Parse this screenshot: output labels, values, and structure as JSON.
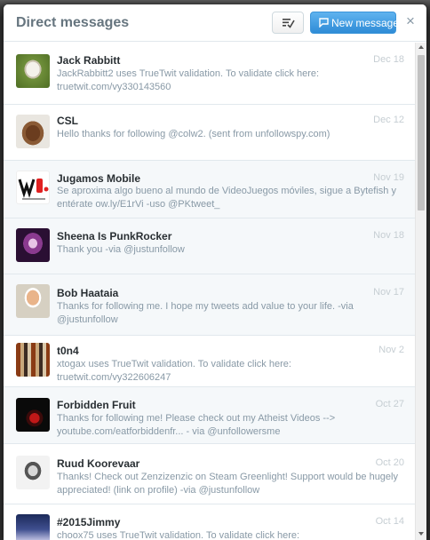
{
  "modal": {
    "title": "Direct messages",
    "new_message_label": "New message",
    "close_glyph": "×",
    "icons": {
      "compose_toggle": "mark-read-icon",
      "new_message": "message-bubble-icon",
      "close": "close-icon"
    },
    "accent_color": "#3b94d9"
  },
  "conversations": [
    {
      "name": "Jack Rabbitt",
      "date": "Dec 18",
      "preview": "JackRabbitt2 uses TrueTwit validation. To validate click here: truetwit.com/vy330143560",
      "avatar_icon": "rabbit-photo-avatar",
      "unread": false
    },
    {
      "name": "CSL",
      "date": "Dec 12",
      "preview": "Hello thanks for following @colw2. (sent from unfollowspy.com)",
      "avatar_icon": "horse-photo-avatar",
      "unread": false
    },
    {
      "name": "Jugamos Mobile",
      "date": "Nov 19",
      "preview": "Se aproxima algo bueno al mundo de VideoJuegos móviles, sigue a Bytefish y entérate ow.ly/E1rVi -uso @PKtweet_",
      "avatar_icon": "jugamos-logo-avatar",
      "unread": true
    },
    {
      "name": "Sheena Is PunkRocker",
      "date": "Nov 18",
      "preview": "Thank you -via @justunfollow",
      "avatar_icon": "portrait-avatar",
      "unread": true
    },
    {
      "name": "Bob Haataia",
      "date": "Nov 17",
      "preview": "Thanks for following me. I hope my tweets add value to your life. -via @justunfollow",
      "avatar_icon": "man-photo-avatar",
      "unread": true
    },
    {
      "name": "t0n4",
      "date": "Nov 2",
      "preview": "xtogax uses TrueTwit validation. To validate click here: truetwit.com/vy322606247",
      "avatar_icon": "mosaic-avatar",
      "unread": false
    },
    {
      "name": "Forbidden Fruit",
      "date": "Oct 27",
      "preview": "Thanks for following me! Please check out my Atheist Videos --> youtube.com/eatforbiddenfr... - via @unfollowersme",
      "avatar_icon": "dark-fruit-avatar",
      "unread": true
    },
    {
      "name": "Ruud Koorevaar",
      "date": "Oct 20",
      "preview": "Thanks! Check out Zenzizenzic on Steam Greenlight! Support would be hugely appreciated! (link on profile) -via @justunfollow",
      "avatar_icon": "sketch-face-avatar",
      "unread": false
    },
    {
      "name": "#2015Jimmy",
      "date": "Oct 14",
      "preview": "choox75 uses TrueTwit validation. To validate click here:",
      "avatar_icon": "night-city-avatar",
      "unread": false
    }
  ]
}
